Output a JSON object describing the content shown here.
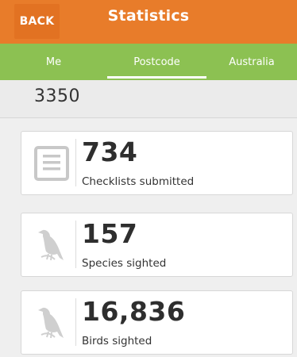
{
  "header": {
    "back_label": "BACK",
    "title": "Statistics"
  },
  "tabs": [
    {
      "label": "Me",
      "selected": false
    },
    {
      "label": "Postcode",
      "selected": true
    },
    {
      "label": "Australia",
      "selected": false
    }
  ],
  "location": {
    "postcode": "3350"
  },
  "stats": [
    {
      "value": "734",
      "label": "Checklists submitted",
      "icon": "checklist-icon"
    },
    {
      "value": "157",
      "label": "Species sighted",
      "icon": "bird-icon"
    },
    {
      "value": "16,836",
      "label": "Birds sighted",
      "icon": "bird-icon"
    }
  ],
  "colors": {
    "header": "#e87c2a",
    "tabs": "#8cc152",
    "background": "#efefef"
  }
}
